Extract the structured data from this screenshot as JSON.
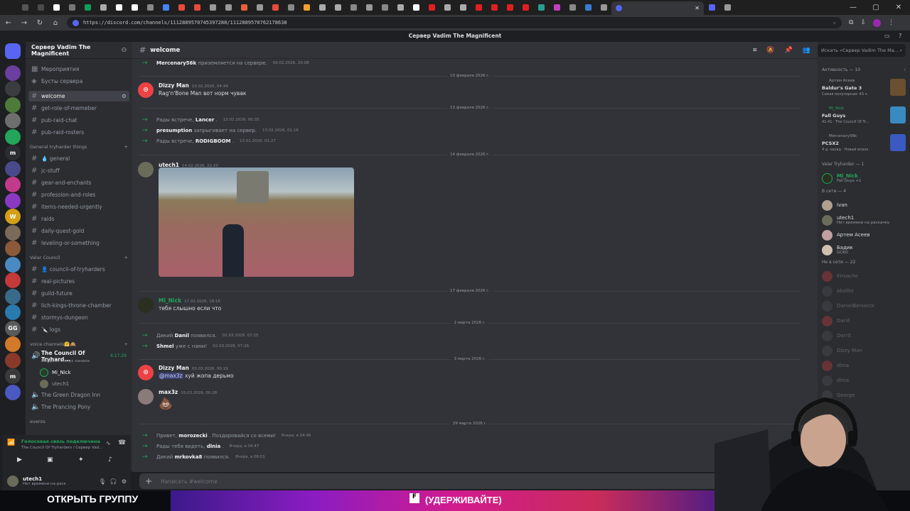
{
  "browser": {
    "url": "https://discord.com/channels/1112889570745397288/1112889570762178638",
    "active_tab_icon": "discord-icon",
    "tab_favicon_colors": [
      "#555",
      "#4a4a4a",
      "#fff",
      "#777",
      "#0f9d58",
      "#aaa",
      "#fff",
      "#fff",
      "#888",
      "#4285f4",
      "#e84a3a",
      "#e84a3a",
      "#999",
      "#999",
      "#e8603a",
      "#999",
      "#e84a3a",
      "#888",
      "#f0a030",
      "#aaa",
      "#aaa",
      "#888",
      "#999",
      "#888",
      "#aaa",
      "#fff",
      "#e02020",
      "#aaa",
      "#aaa",
      "#e02020",
      "#e02020",
      "#e02020",
      "#e02020",
      "#2a9d8f",
      "#c040c0",
      "#888",
      "#3a7bd5",
      "#999",
      "#5865f2",
      "#999"
    ]
  },
  "window_title": "Сервер Vadim The Magnificent",
  "server": {
    "name": "Сервер Vadim The Magnificent",
    "top_items": [
      "Мероприятия",
      "Бусты сервера"
    ],
    "channels_top": [
      "welcome",
      "get-role-of-memeber",
      "pub-raid-chat",
      "pub-raid-rosters"
    ],
    "category1": "General tryharder things",
    "channels_cat1": [
      "💧 general",
      "jc-stuff",
      "gear-and-enchants",
      "profession-and-roles",
      "items-needed-urgently",
      "raids",
      "daily-quest-gold",
      "leveling-or-something"
    ],
    "category2": "Valar Council",
    "channels_cat2": [
      "👤 council-of-tryharders",
      "real-pictures",
      "guild-future",
      "lich-kings-throne-chamber",
      "stormys-dungeon",
      "🔪 logs"
    ],
    "category3": "voice channels🤗🙈",
    "voice_channel": "The Council Of Tryhard...",
    "voice_timer": "4:17:29",
    "voice_status": "Выбрать статус канала",
    "voice_users": [
      "Mi_Nick",
      "utech1"
    ],
    "voice_channels_other": [
      "The Green Dragon Inn",
      "The Prancing Pony"
    ],
    "category4": "events"
  },
  "voice_panel": {
    "status": "Голосовая связь подключена",
    "location": "The Council Of Tryharders / Сервер Vad..."
  },
  "user": {
    "name": "utech1",
    "status": "Нет времени на раск"
  },
  "chat": {
    "channel": "welcome",
    "composer_placeholder": "Написать #welcome",
    "items": [
      {
        "kind": "sys",
        "pre": "",
        "name": "Mercenary56k",
        "post": "приземляется на сервере.",
        "ts": "09.02.2026, 20:08"
      },
      {
        "kind": "div",
        "text": "10 февраля 2026 г."
      },
      {
        "kind": "msg",
        "name": "Dizzy Man",
        "ts": "10.02.2026, 04:44",
        "body": "Rag'n'Bone Man вот норм чувак"
      },
      {
        "kind": "div",
        "text": "13 февраля 2026 г."
      },
      {
        "kind": "sys",
        "pre": "Рады встрече,",
        "name": "Lancer",
        "post": ".",
        "ts": "13.02.2026, 00:35"
      },
      {
        "kind": "sys",
        "pre": "",
        "name": "presumption",
        "post": "запрыгивает на сервер.",
        "ts": "13.02.2026, 01:16"
      },
      {
        "kind": "sys",
        "pre": "Рады встрече,",
        "name": "RODIGBOOM",
        "post": ".",
        "ts": "13.02.2026, 01:27"
      },
      {
        "kind": "div",
        "text": "14 февраля 2026 г."
      },
      {
        "kind": "msg",
        "name": "utech1",
        "ts": "14.02.2026, 22:20",
        "body": ""
      },
      {
        "kind": "div",
        "text": "17 февраля 2026 г."
      },
      {
        "kind": "msg",
        "name": "Mi_Nick",
        "ts": "17.02.2026, 18:16",
        "body": "тебя слышно если что"
      },
      {
        "kind": "div",
        "text": "2 марта 2026 г."
      },
      {
        "kind": "sys",
        "pre": "Дикий",
        "name": "Danil",
        "post": "появился.",
        "ts": "02.03.2026, 07:25"
      },
      {
        "kind": "sys",
        "pre": "",
        "name": "Shmel",
        "post": "уже с нами!",
        "ts": "02.03.2026, 07:26"
      },
      {
        "kind": "div",
        "text": "3 марта 2026 г."
      },
      {
        "kind": "msg",
        "name": "Dizzy Man",
        "ts": "03.03.2026, 00:19",
        "mention": "@max3z",
        "body": "хуй жопа дерьмо"
      },
      {
        "kind": "msg",
        "name": "max3z",
        "ts": "03.03.2026, 00:28",
        "body": "💩"
      },
      {
        "kind": "div",
        "text": "29 марта 2026 г."
      },
      {
        "kind": "sys",
        "pre": "Привет,",
        "name": "morozecki",
        "post": ". Поздоровайся со всеми!",
        "ts": "Вчера, в 04:46"
      },
      {
        "kind": "sys",
        "pre": "Рады тебя видеть,",
        "name": "dlnia",
        "post": ".",
        "ts": "Вчера, в 04:47"
      },
      {
        "kind": "sys",
        "pre": "Дикий",
        "name": "mrkovka8",
        "post": "появился.",
        "ts": "Вчера, в 06:01"
      }
    ]
  },
  "members": {
    "search_placeholder": "Искать «Сервер Vadim The Ma...",
    "activity_header": "Активность — 10",
    "activities": [
      {
        "user": "Артем Асеев",
        "game": "Baldur's Gate 3",
        "detail": "Самая популярная: 43 ч."
      },
      {
        "user": "Mi_Nick",
        "game": "Fall Guys",
        "detail": "41:41 · The Council Of Tr..."
      },
      {
        "user": "Mercenary56k",
        "game": "PCSX2",
        "detail": "4 д. назад · Новый игрок"
      }
    ],
    "role_header": "Valar Tryharder — 1",
    "role_members": [
      {
        "name": "Mi_Nick",
        "sub": "Fall Guys +1"
      }
    ],
    "online_header": "В сети — 4",
    "online": [
      {
        "name": "Ivan",
        "sub": ""
      },
      {
        "name": "utech1",
        "sub": "Нет времени на раскачку"
      },
      {
        "name": "Артем Асеев",
        "sub": ""
      },
      {
        "name": "Бадик",
        "sub": "GCKO"
      }
    ],
    "offline_header": "Не в сети — 22",
    "offline": [
      "Kirsache",
      "Akolito",
      "DanielBerserck",
      "Danil",
      "Dorrit",
      "Dizzy Man",
      "dlnia",
      "dlnia",
      "George",
      "goat"
    ]
  },
  "banner": {
    "left": "ОТКРЫТЬ ГРУППУ",
    "right": "(УДЕРЖИВАЙТЕ)"
  }
}
